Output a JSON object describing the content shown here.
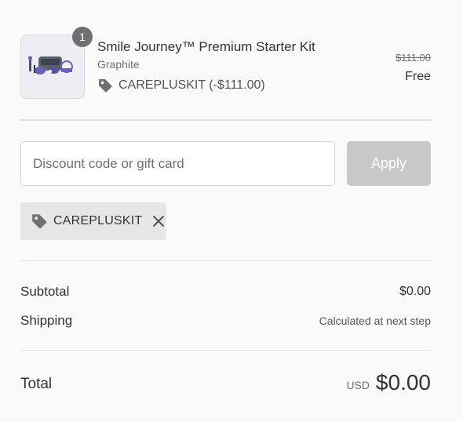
{
  "product": {
    "quantity": "1",
    "title": "Smile Journey™ Premium Starter Kit",
    "variant": "Graphite",
    "discount_line": "CAREPLUSKIT (-$111.00)",
    "original_price": "$111.00",
    "price": "Free",
    "tag_icon": "tag-icon"
  },
  "discount_form": {
    "placeholder": "Discount code or gift card",
    "value": "",
    "apply_label": "Apply"
  },
  "applied_code": {
    "code": "CAREPLUSKIT",
    "tag_icon": "tag-icon",
    "remove_icon": "close-icon"
  },
  "summary": {
    "subtotal_label": "Subtotal",
    "subtotal_value": "$0.00",
    "shipping_label": "Shipping",
    "shipping_value": "Calculated at next step"
  },
  "total": {
    "label": "Total",
    "currency": "USD",
    "amount": "$0.00"
  },
  "colors": {
    "background": "#fafafa",
    "apply_disabled": "#c8c8c8",
    "badge": "#707070",
    "chip": "#e6e6e6"
  }
}
